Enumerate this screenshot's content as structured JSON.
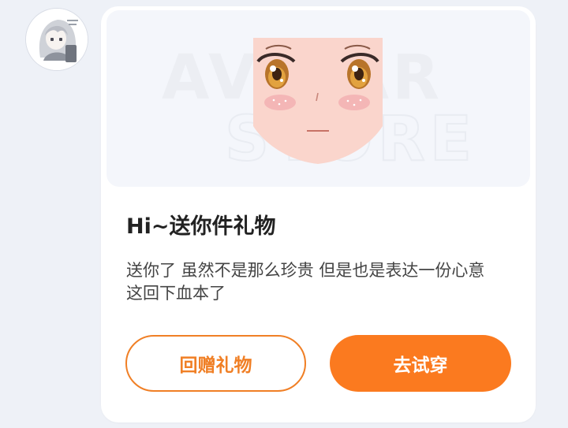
{
  "sender": {
    "avatar_icon": "anime-girl-avatar"
  },
  "gift_card": {
    "preview_watermark": [
      "AVATAR",
      "STORE"
    ],
    "preview_item": "anime-face-makeup",
    "title": "Hi~送你件礼物",
    "description": "送你了 虽然不是那么珍贵 但是也是表达一份心意 这回下血本了",
    "return_gift_label": "回赠礼物",
    "try_on_label": "去试穿"
  },
  "colors": {
    "background": "#eef1f7",
    "card": "#ffffff",
    "accent": "#fb7a1f",
    "accent_border": "#f07f25"
  }
}
